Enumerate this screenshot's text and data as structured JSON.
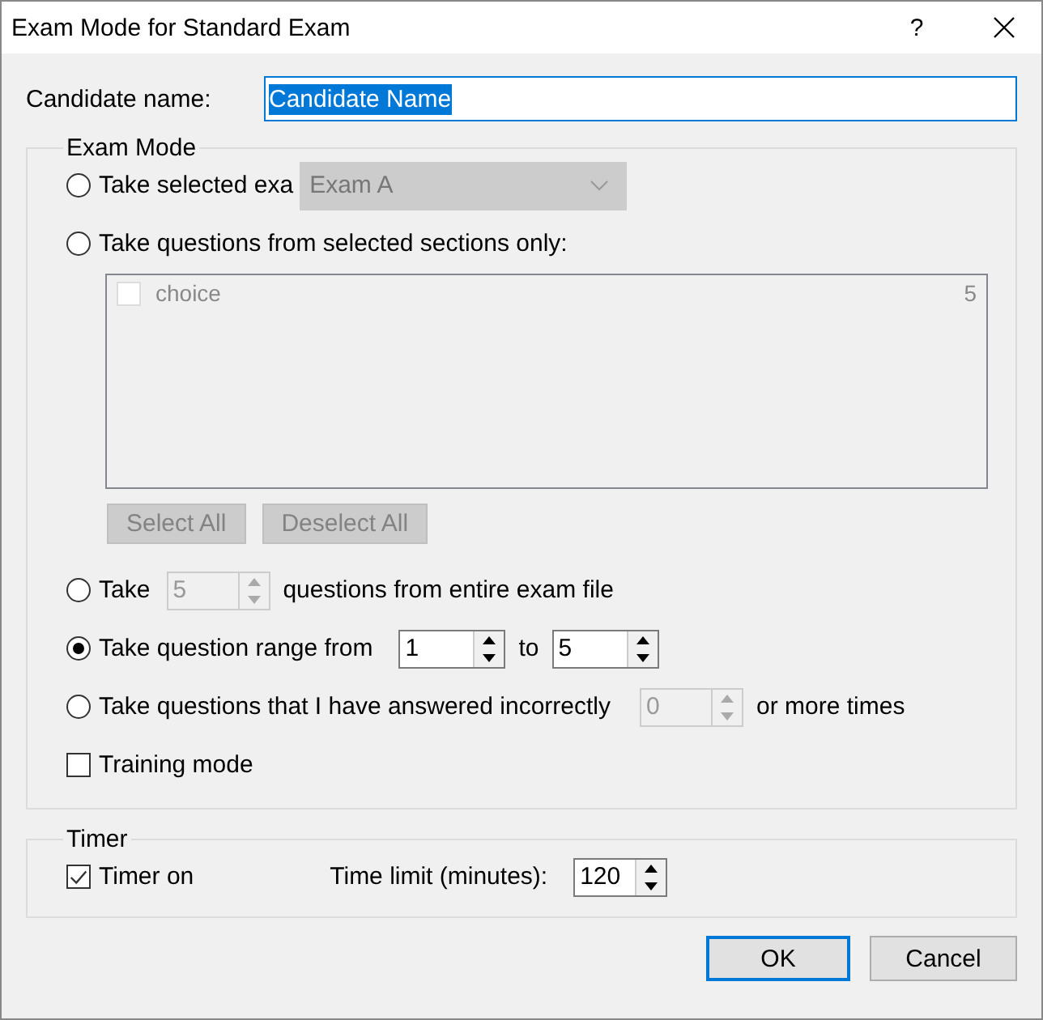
{
  "window": {
    "title": "Exam Mode for Standard Exam",
    "help": "?"
  },
  "candidate": {
    "label": "Candidate name:",
    "value": "Candidate Name"
  },
  "exam_mode": {
    "title": "Exam Mode",
    "options": [
      {
        "kind": "exam",
        "label": "Take selected exa",
        "selected": false,
        "dropdown": {
          "value": "Exam A",
          "disabled": true
        }
      },
      {
        "kind": "sections",
        "label": "Take questions from selected sections only:",
        "selected": false,
        "disabled": true,
        "sections": [
          {
            "name": "choice",
            "count": "5",
            "checked": false
          }
        ],
        "buttons": [
          "Select All",
          "Deselect All"
        ]
      },
      {
        "kind": "count",
        "label": "Take",
        "selected": false,
        "spinner": {
          "value": "5",
          "disabled": true
        },
        "suffix": "questions from entire exam file"
      },
      {
        "kind": "range",
        "label": "Take question range from",
        "selected": true,
        "from": {
          "value": "1",
          "disabled": false
        },
        "to_label": "to",
        "to": {
          "value": "5",
          "disabled": false
        }
      },
      {
        "kind": "incorrect",
        "label": "Take questions that I have answered incorrectly",
        "selected": false,
        "spinner": {
          "value": "0",
          "disabled": true
        },
        "suffix": "or more times"
      }
    ],
    "training": {
      "label": "Training mode",
      "checked": false
    }
  },
  "timer": {
    "title": "Timer",
    "checkbox": {
      "label": "Timer on",
      "checked": true
    },
    "limit_label": "Time limit (minutes):",
    "limit": {
      "value": "120",
      "disabled": false
    }
  },
  "buttons": [
    {
      "label": "OK",
      "default": true
    },
    {
      "label": "Cancel",
      "default": false
    }
  ]
}
